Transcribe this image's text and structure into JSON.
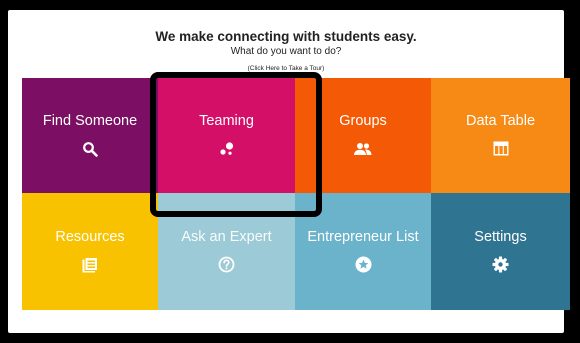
{
  "header": {
    "title": "We make connecting with students easy.",
    "subtitle": "What do you want to do?",
    "tour_link": "(Click Here to Take a Tour)"
  },
  "tiles": [
    {
      "label": "Find Someone",
      "icon": "search-icon",
      "color": "#7c0f63"
    },
    {
      "label": "Teaming",
      "icon": "teaming-dots-icon",
      "color": "#d40f67"
    },
    {
      "label": "Groups",
      "icon": "people-icon",
      "color": "#f45a05"
    },
    {
      "label": "Data Table",
      "icon": "table-icon",
      "color": "#f68a14"
    },
    {
      "label": "Resources",
      "icon": "document-list-icon",
      "color": "#f8c200"
    },
    {
      "label": "Ask an Expert",
      "icon": "question-circle-icon",
      "color": "#9ccad6"
    },
    {
      "label": "Entrepreneur List",
      "icon": "star-circle-icon",
      "color": "#6ab3cb"
    },
    {
      "label": "Settings",
      "icon": "gear-icon",
      "color": "#2f7490"
    }
  ]
}
